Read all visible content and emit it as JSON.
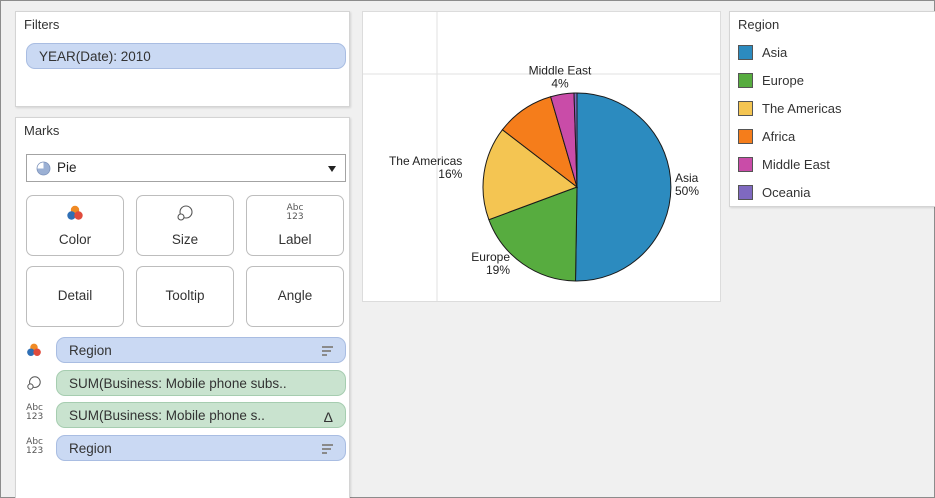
{
  "filters": {
    "title": "Filters",
    "items": [
      {
        "label": "YEAR(Date): 2010"
      }
    ]
  },
  "marks": {
    "title": "Marks",
    "mark_type": "Pie",
    "buttons": [
      {
        "label": "Color",
        "icon": "color-icon"
      },
      {
        "label": "Size",
        "icon": "size-icon"
      },
      {
        "label": "Label",
        "icon": "label-icon"
      },
      {
        "label": "Detail"
      },
      {
        "label": "Tooltip"
      },
      {
        "label": "Angle"
      }
    ],
    "shelf": [
      {
        "icon": "color-icon",
        "label": "Region",
        "pill_color": "blue",
        "trailing_icon": "sort-icon"
      },
      {
        "icon": "size-icon",
        "label": "SUM(Business: Mobile phone subs..",
        "pill_color": "green"
      },
      {
        "icon": "label-icon",
        "label": "SUM(Business: Mobile phone s..",
        "pill_color": "green",
        "trailing_icon": "delta-icon",
        "trailing_text": "Δ"
      },
      {
        "icon": "label-icon",
        "label": "Region",
        "pill_color": "blue",
        "trailing_icon": "sort-icon"
      }
    ],
    "label_icon_text": [
      "Abc",
      "123"
    ]
  },
  "legend": {
    "title": "Region",
    "items": [
      {
        "label": "Asia",
        "color": "#2c8bbf"
      },
      {
        "label": "Europe",
        "color": "#57ac3f"
      },
      {
        "label": "The Americas",
        "color": "#f4c552"
      },
      {
        "label": "Africa",
        "color": "#f57d1b"
      },
      {
        "label": "Middle East",
        "color": "#c94ca8"
      },
      {
        "label": "Oceania",
        "color": "#7f69c0"
      }
    ]
  },
  "chart_data": {
    "type": "pie",
    "categories": [
      "Asia",
      "Europe",
      "The Americas",
      "Africa",
      "Middle East",
      "Oceania"
    ],
    "values": [
      50,
      19,
      16,
      10,
      4,
      0.5
    ],
    "labels": [
      "Asia\n50%",
      "Europe\n19%",
      "The Americas\n16%",
      "",
      "Middle East\n4%",
      ""
    ],
    "colors": [
      "#2c8bbf",
      "#57ac3f",
      "#f4c552",
      "#f57d1b",
      "#c94ca8",
      "#7f69c0"
    ],
    "start_angle_deg": 0,
    "direction": "clockwise"
  }
}
